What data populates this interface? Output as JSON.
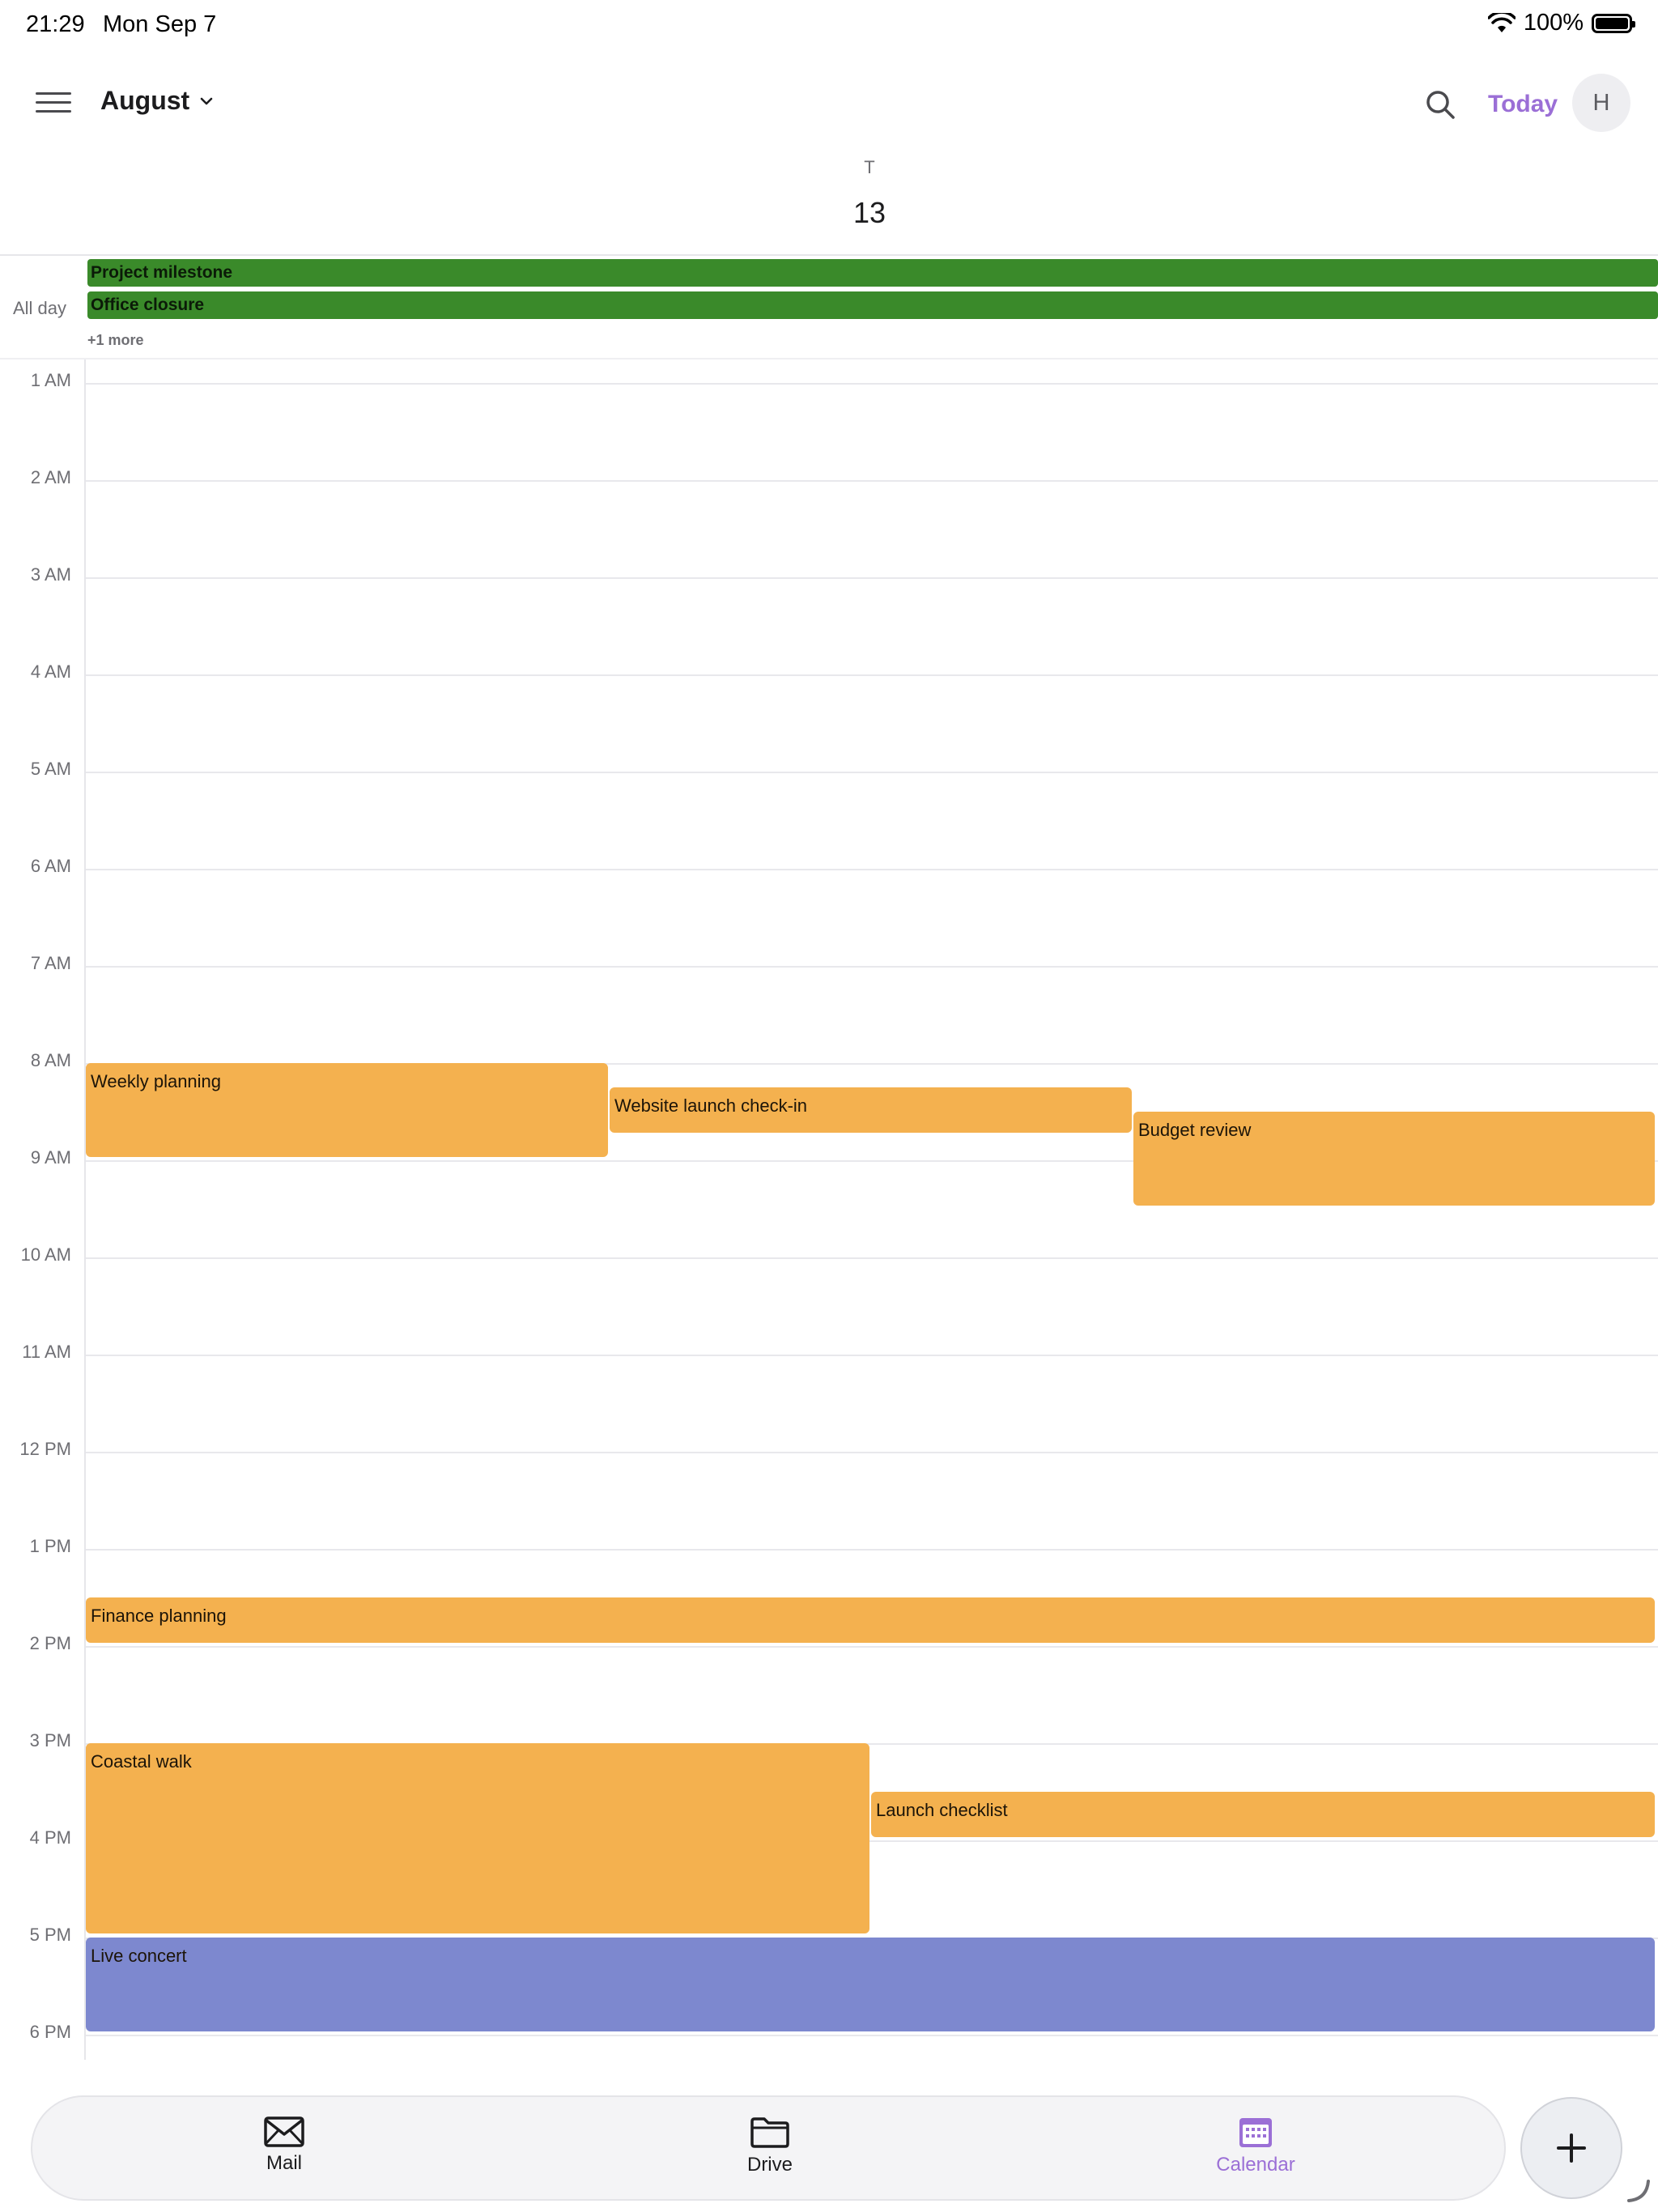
{
  "status_bar": {
    "time": "21:29",
    "date": "Mon Sep 7",
    "battery": "100%"
  },
  "header": {
    "month": "August",
    "today_label": "Today",
    "avatar_initial": "H"
  },
  "day": {
    "weekday_letter": "T",
    "day_number": "13"
  },
  "all_day": {
    "label": "All day",
    "events": [
      "Project milestone",
      "Office closure"
    ],
    "more": "+1 more"
  },
  "hours": [
    "1 AM",
    "2 AM",
    "3 AM",
    "4 AM",
    "5 AM",
    "6 AM",
    "7 AM",
    "8 AM",
    "9 AM",
    "10 AM",
    "11 AM",
    "12 PM",
    "1 PM",
    "2 PM",
    "3 PM",
    "4 PM",
    "5 PM",
    "6 PM"
  ],
  "events": {
    "weekly_planning": "Weekly planning",
    "website_launch": "Website launch check-in",
    "budget_review": "Budget review",
    "finance_planning": "Finance planning",
    "coastal_walk": "Coastal walk",
    "launch_checklist": "Launch checklist",
    "live_concert": "Live concert"
  },
  "tabs": {
    "mail": "Mail",
    "drive": "Drive",
    "calendar": "Calendar"
  },
  "colors": {
    "accent": "#9b6fd6",
    "allday_green": "#3a8a2a",
    "event_orange": "#f4b14f",
    "event_purple": "#7d88cf"
  }
}
